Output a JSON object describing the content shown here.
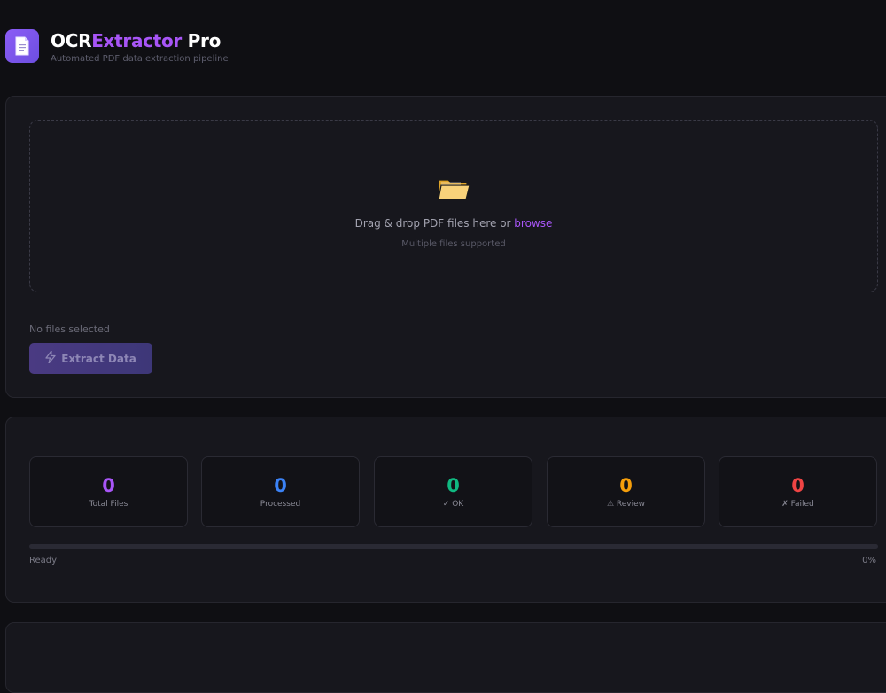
{
  "app": {
    "title_part1": "OCR",
    "title_part2": "Extractor",
    "title_part3": " Pro",
    "subtitle": "Automated PDF data extraction pipeline",
    "logo_icon": "document-icon"
  },
  "upload": {
    "folder_icon": "folder-icon",
    "drop_text": "Drag & drop PDF files here or ",
    "browse_label": "browse",
    "hint": "Multiple files supported",
    "file_status": "No files selected",
    "extract_label": "Extract Data",
    "extract_icon": "lightning-icon"
  },
  "stats": [
    {
      "value": "0",
      "label": "Total Files",
      "color": "#a855f7"
    },
    {
      "value": "0",
      "label": "Processed",
      "color": "#3b82f6"
    },
    {
      "value": "0",
      "label": "✓ OK",
      "color": "#10b981"
    },
    {
      "value": "0",
      "label": "⚠ Review",
      "color": "#f59e0b"
    },
    {
      "value": "0",
      "label": "✗ Failed",
      "color": "#ef4444"
    }
  ],
  "progress": {
    "status": "Ready",
    "percent_label": "0%",
    "fraction": 0
  },
  "colors": {
    "accent": "#a855f7",
    "background": "#0f0f13",
    "panel": "#17171d"
  }
}
